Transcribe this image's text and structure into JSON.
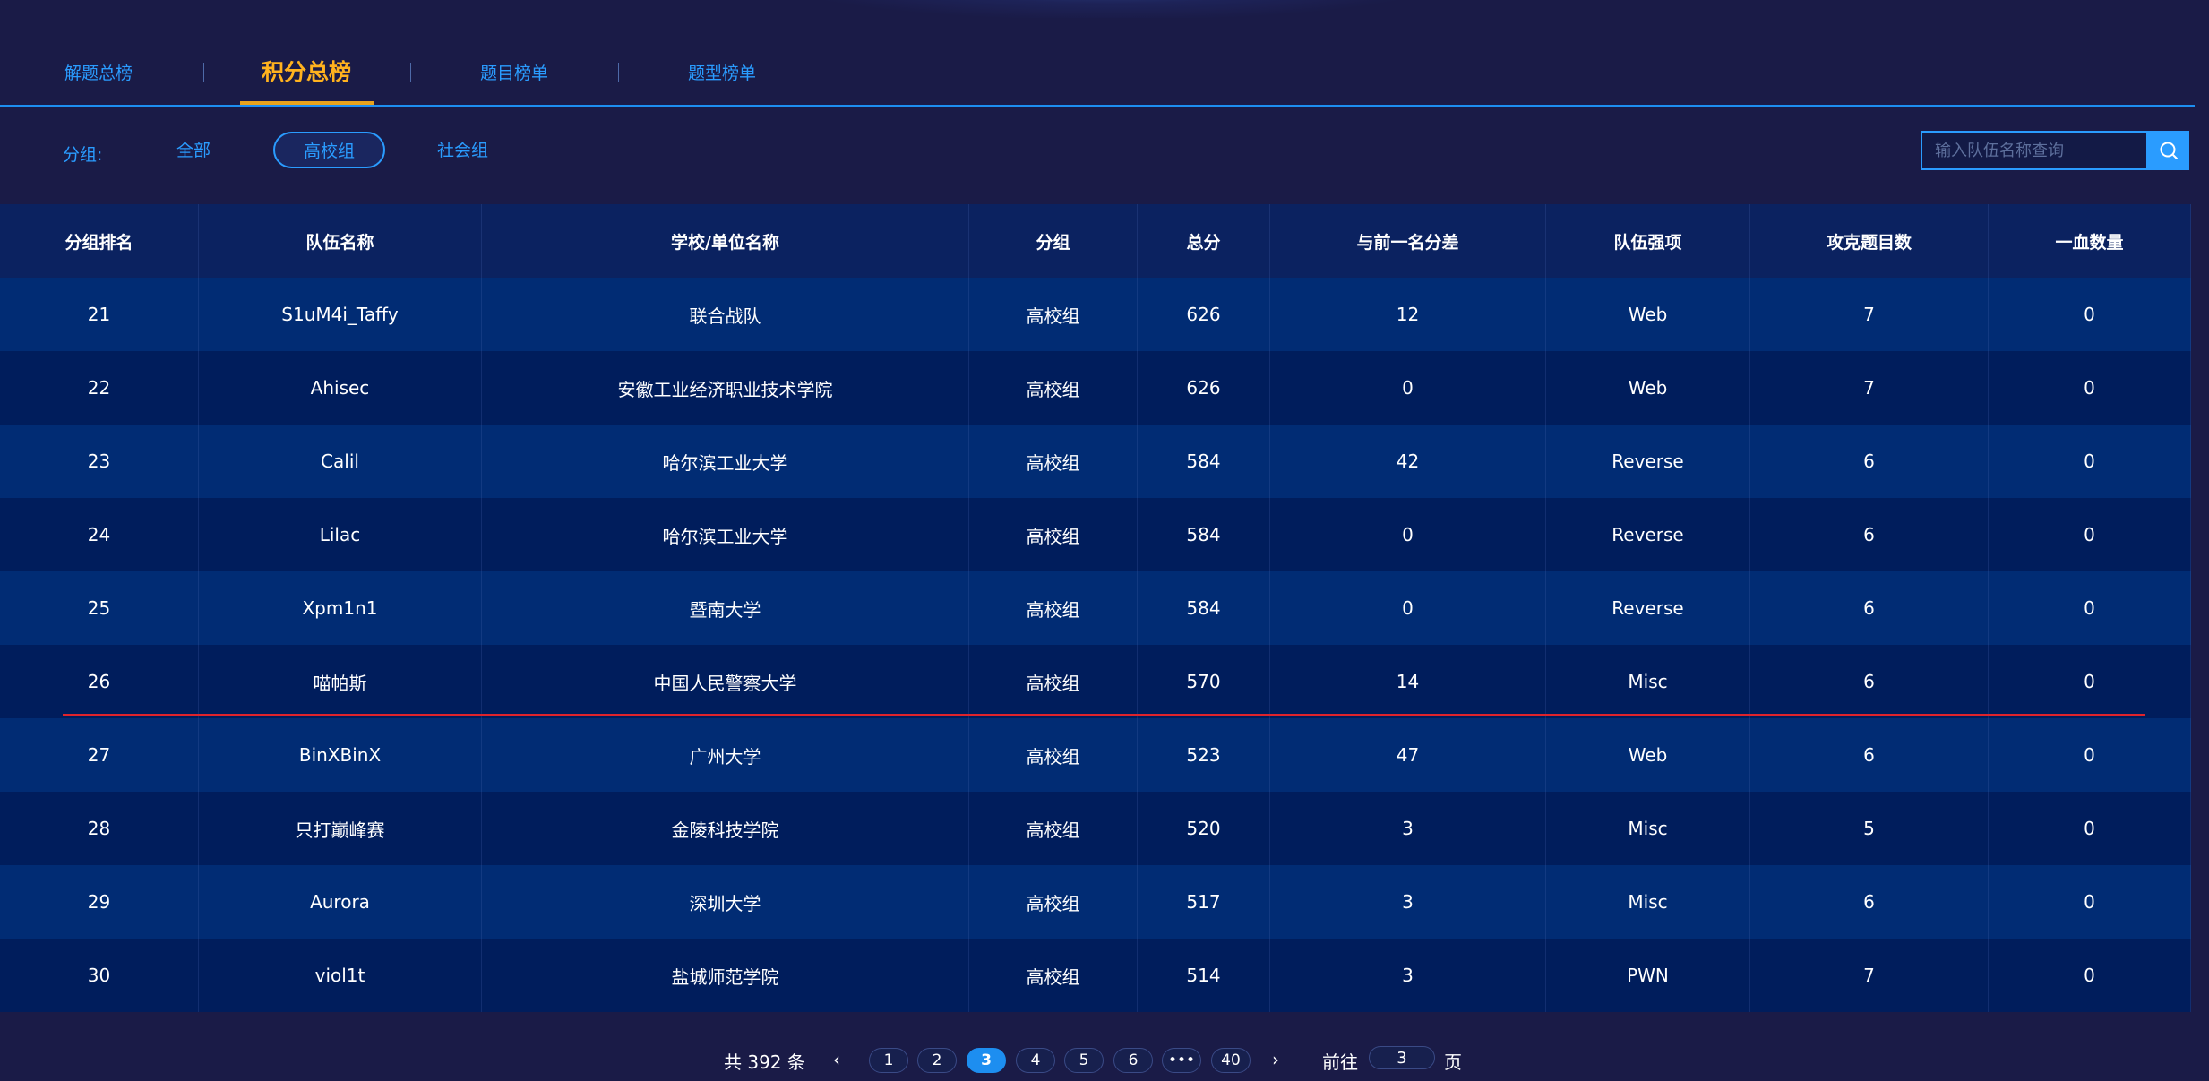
{
  "tabs": [
    {
      "label": "解题总榜"
    },
    {
      "label": "积分总榜"
    },
    {
      "label": "题目榜单"
    },
    {
      "label": "题型榜单"
    }
  ],
  "filter": {
    "label": "分组:",
    "options": [
      {
        "label": "全部"
      },
      {
        "label": "高校组"
      },
      {
        "label": "社会组"
      }
    ],
    "selected": "高校组"
  },
  "search": {
    "placeholder": "输入队伍名称查询"
  },
  "table": {
    "headers": [
      "分组排名",
      "队伍名称",
      "学校/单位名称",
      "分组",
      "总分",
      "与前一名分差",
      "队伍强项",
      "攻克题目数",
      "一血数量"
    ],
    "rows": [
      [
        "21",
        "S1uM4i_Taffy",
        "联合战队",
        "高校组",
        "626",
        "12",
        "Web",
        "7",
        "0"
      ],
      [
        "22",
        "Ahisec",
        "安徽工业经济职业技术学院",
        "高校组",
        "626",
        "0",
        "Web",
        "7",
        "0"
      ],
      [
        "23",
        "Calil",
        "哈尔滨工业大学",
        "高校组",
        "584",
        "42",
        "Reverse",
        "6",
        "0"
      ],
      [
        "24",
        "Lilac",
        "哈尔滨工业大学",
        "高校组",
        "584",
        "0",
        "Reverse",
        "6",
        "0"
      ],
      [
        "25",
        "Xpm1n1",
        "暨南大学",
        "高校组",
        "584",
        "0",
        "Reverse",
        "6",
        "0"
      ],
      [
        "26",
        "喵帕斯",
        "中国人民警察大学",
        "高校组",
        "570",
        "14",
        "Misc",
        "6",
        "0"
      ],
      [
        "27",
        "BinXBinX",
        "广州大学",
        "高校组",
        "523",
        "47",
        "Web",
        "6",
        "0"
      ],
      [
        "28",
        "只打巅峰赛",
        "金陵科技学院",
        "高校组",
        "520",
        "3",
        "Misc",
        "5",
        "0"
      ],
      [
        "29",
        "Aurora",
        "深圳大学",
        "高校组",
        "517",
        "3",
        "Misc",
        "6",
        "0"
      ],
      [
        "30",
        "viol1t",
        "盐城师范学院",
        "高校组",
        "514",
        "3",
        "PWN",
        "7",
        "0"
      ]
    ]
  },
  "pagination": {
    "total": "共 392 条",
    "pages": [
      "1",
      "2",
      "3",
      "4",
      "5",
      "6",
      "•••",
      "40"
    ],
    "current": "3",
    "goto_label": "前往",
    "goto_value": "3",
    "goto_unit": "页"
  },
  "colors": {
    "accent": "#2a9cff",
    "active_tab": "#ffb21e",
    "highlight_line": "#e0232b"
  }
}
